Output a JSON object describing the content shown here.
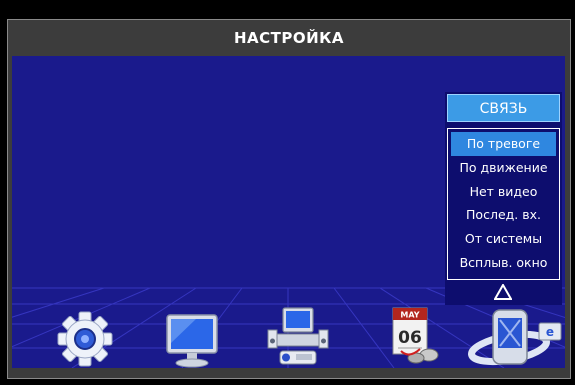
{
  "window": {
    "title": "НАСТРОЙКА"
  },
  "menu": {
    "header": "СВЯЗЬ",
    "items": [
      {
        "label": "По тревоге",
        "selected": true
      },
      {
        "label": "По движение",
        "selected": false
      },
      {
        "label": "Нет видео",
        "selected": false
      },
      {
        "label": "Послед. вх.",
        "selected": false
      },
      {
        "label": "От системы",
        "selected": false
      },
      {
        "label": "Всплыв. окно",
        "selected": false
      }
    ],
    "more_icon": "triangle-up-icon"
  },
  "toolbar": {
    "icons": [
      {
        "name": "gear-icon"
      },
      {
        "name": "monitor-icon"
      },
      {
        "name": "network-computer-icon"
      },
      {
        "name": "calendar-icon",
        "month": "MAY",
        "day": "06"
      },
      {
        "name": "connection-globe-icon",
        "badge": "e"
      }
    ]
  },
  "colors": {
    "background": "#1a1a8c",
    "accent": "#3c9be6",
    "frame": "#3c3c3c",
    "text": "#ffffff"
  }
}
